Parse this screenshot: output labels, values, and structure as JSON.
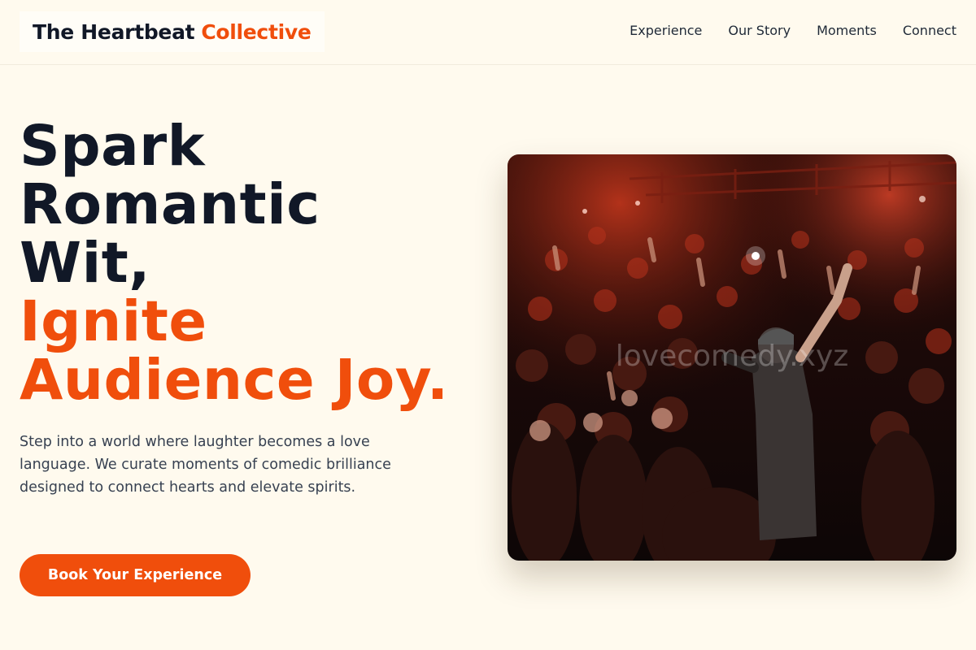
{
  "brand": {
    "name": "The Heartbeat",
    "accent": "Collective"
  },
  "nav": {
    "items": [
      "Experience",
      "Our Story",
      "Moments",
      "Connect"
    ]
  },
  "hero": {
    "title_lines_dark": [
      "Spark",
      "Romantic",
      "Wit,"
    ],
    "title_lines_accent": [
      "Ignite",
      "Audience Joy."
    ],
    "description": "Step into a world where laughter becomes a love language. We curate moments of comedic brilliance designed to connect hearts and elevate spirits.",
    "cta_label": "Book Your Experience"
  },
  "image": {
    "subject": "concert crowd with performer on stage",
    "watermark": "lovecomedy.xyz"
  },
  "colors": {
    "background": "#fffaee",
    "accent": "#f04e0c",
    "heading": "#111827",
    "body_text": "#374151"
  }
}
